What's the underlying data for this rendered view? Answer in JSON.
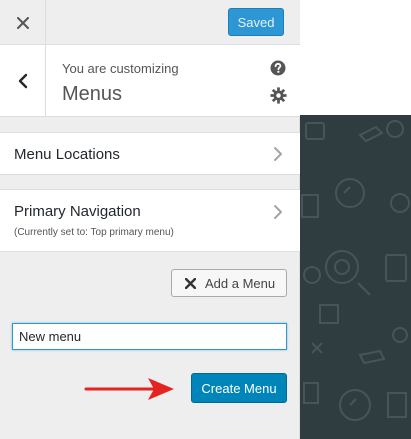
{
  "topbar": {
    "close_icon": "close-icon",
    "saved_label": "Saved"
  },
  "header": {
    "back_icon": "chevron-left-icon",
    "customizing_text": "You are customizing",
    "section_title": "Menus",
    "help_icon": "help-icon",
    "settings_icon": "gear-icon"
  },
  "panels": [
    {
      "title": "Menu Locations",
      "subtitle": ""
    },
    {
      "title": "Primary Navigation",
      "subtitle": "(Currently set to: Top primary menu)"
    }
  ],
  "add_menu": {
    "label": "Add a Menu",
    "icon": "x-icon"
  },
  "new_menu": {
    "input_value": "New menu",
    "create_label": "Create Menu"
  },
  "annotation": {
    "arrow_icon": "red-arrow-icon",
    "arrow_color": "#e52320"
  },
  "colors": {
    "accent": "#0085ba",
    "saved_button": "#2d96d4",
    "preview_bg": "#2f3d40"
  }
}
